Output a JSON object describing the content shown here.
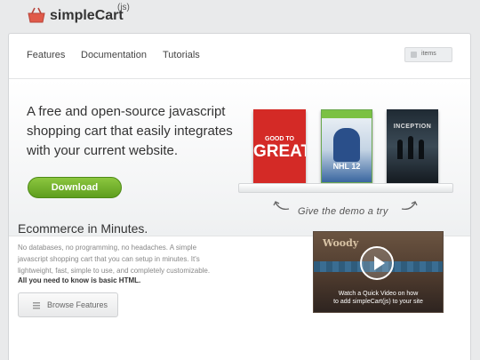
{
  "brand": {
    "name": "simpleCart",
    "suffix": "(js)"
  },
  "nav": {
    "items": [
      "Features",
      "Documentation",
      "Tutorials"
    ],
    "cart_label": "items"
  },
  "hero": {
    "headline": "A free and open-source javascript shopping cart that easily integrates with your current website.",
    "download_label": "Download",
    "products": {
      "book": {
        "top_text": "GOOD TO",
        "title": "GREAT"
      },
      "game": {
        "title": "NHL 12"
      },
      "movie": {
        "title": "INCEPTION"
      }
    },
    "demo_label": "Give the demo a try"
  },
  "section": {
    "title": "Ecommerce in Minutes.",
    "body": "No databases, no programming, no headaches. A simple javascript shopping cart that you can setup in minutes. It's lightweight, fast, simple to use, and completely customizable.",
    "bold": "All you need to know is basic HTML.",
    "browse_label": "Browse Features"
  },
  "video": {
    "sign": "Woody",
    "caption_line1": "Watch a Quick Video on how",
    "caption_line2": "to add simpleCart(js) to your site"
  },
  "colors": {
    "download_green": "#6bab2a",
    "book_red": "#d42a26",
    "awning_blue": "#2f5c7c"
  }
}
